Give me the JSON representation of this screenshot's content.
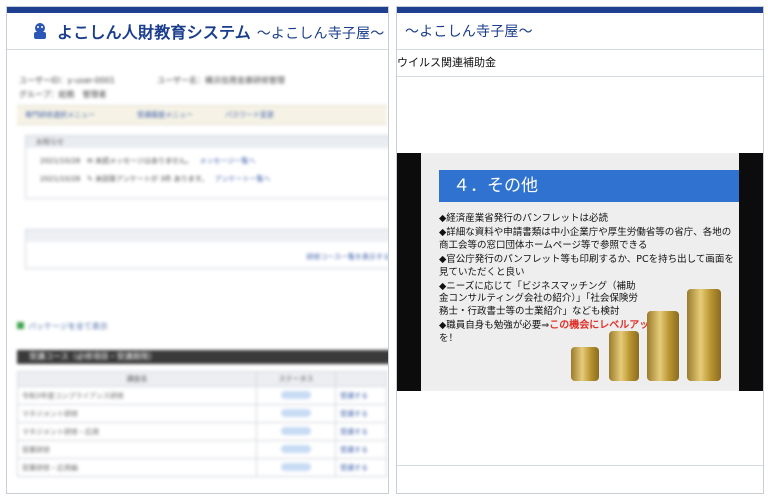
{
  "left_panel": {
    "app_title": "よこしん人財教育システム",
    "app_subtitle": "〜よこしん寺子屋〜",
    "user_id_label": "ユーザーID：",
    "user_id_value": "y-user-0001",
    "user_name_label": "ユーザー名：",
    "user_name_value": "横浜信用金庫研修管理",
    "group_label": "グループ：",
    "group_value": "総務　管理者",
    "nav_items": [
      "専門研修選択メニュー",
      "受講履歴メニュー",
      "パスワード変更"
    ],
    "notices_header": "お知らせ",
    "notices": [
      {
        "date": "2021/10/28",
        "text": "未読メッセージはありません。",
        "link": "メッセージ一覧へ"
      },
      {
        "date": "2021/10/28",
        "text": "未回答アンケートが 3件 あります。",
        "link": "アンケート一覧へ"
      }
    ],
    "list_link": "研修コース一覧を表示する",
    "section_link": "パッケージを全て表示",
    "course_section_title": "受講コース（必修項目・受講期限）",
    "table_headers": [
      "講座名",
      "ステータス",
      ""
    ],
    "table_rows": [
      {
        "name": "令和3年度コンプライアンス研修",
        "action": "受講する"
      },
      {
        "name": "マネジメント研修",
        "action": "受講する"
      },
      {
        "name": "マネジメント研修・応用",
        "action": "受講する"
      },
      {
        "name": "営業研修",
        "action": "受講する"
      },
      {
        "name": "営業研修・応用編",
        "action": "受講する"
      }
    ]
  },
  "right_panel": {
    "app_subtitle": "〜よこしん寺子屋〜",
    "breadcrumb": "ウイルス関連補助金",
    "slide": {
      "title": "４．その他",
      "bullets": [
        "◆経済産業省発行のパンフレットは必読",
        "◆詳細な資料や申請書類は中小企業庁や厚生労働省等の省庁、各地の商工会等の窓口団体ホームページ等で参照できる",
        "◆官公庁発行のパンフレット等も印刷するか、PCを持ち出して画面を見ていただくと良い",
        "◆ニーズに応じて「ビジネスマッチング（補助金コンサルティング会社の紹介）」「社会保険労務士・行政書士等の士業紹介」なども検討",
        "◆職員自身も勉強が必要⇒"
      ],
      "highlight_text": "この機会にレベルアップ",
      "tail_text": "を！"
    }
  },
  "colors": {
    "brand_blue": "#1a3d8c",
    "slide_title_bg": "#2f72d0",
    "highlight_red": "#e0322a"
  }
}
